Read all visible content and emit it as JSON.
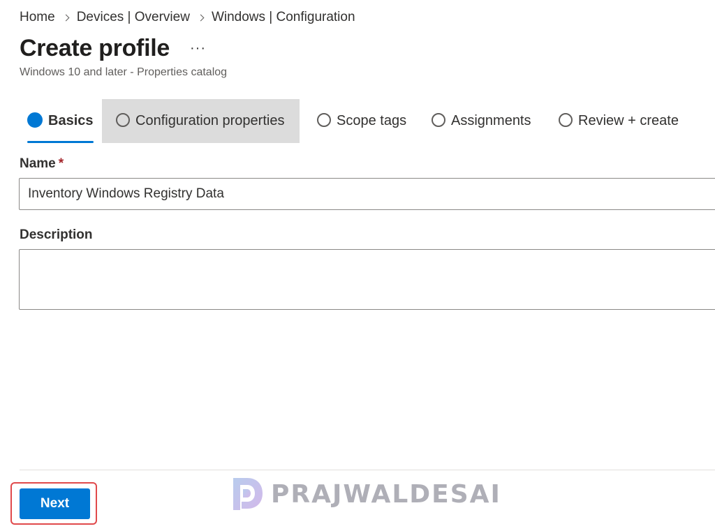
{
  "breadcrumb": {
    "items": [
      "Home",
      "Devices | Overview",
      "Windows | Configuration"
    ]
  },
  "header": {
    "title": "Create profile",
    "more_label": "···",
    "subtitle": "Windows 10 and later - Properties catalog"
  },
  "tabs": [
    {
      "label": "Basics",
      "state": "active"
    },
    {
      "label": "Configuration properties",
      "state": "hover"
    },
    {
      "label": "Scope tags",
      "state": "inactive"
    },
    {
      "label": "Assignments",
      "state": "inactive"
    },
    {
      "label": "Review + create",
      "state": "inactive"
    }
  ],
  "form": {
    "name_label": "Name",
    "name_required_mark": "*",
    "name_value": "Inventory Windows Registry Data",
    "description_label": "Description",
    "description_value": ""
  },
  "footer": {
    "next_label": "Next"
  },
  "watermark": {
    "text": "PRAJWALDESAI"
  },
  "colors": {
    "accent": "#0078d4",
    "required": "#a4262c",
    "highlight_border": "#e0494b",
    "tab_hover_bg": "#dcdcdc"
  },
  "icons": {
    "breadcrumb_separator": "chevron-right-icon",
    "more": "ellipsis-icon",
    "tab_status": "circle-icon",
    "watermark_logo": "prajwaldesai-logo-icon"
  }
}
